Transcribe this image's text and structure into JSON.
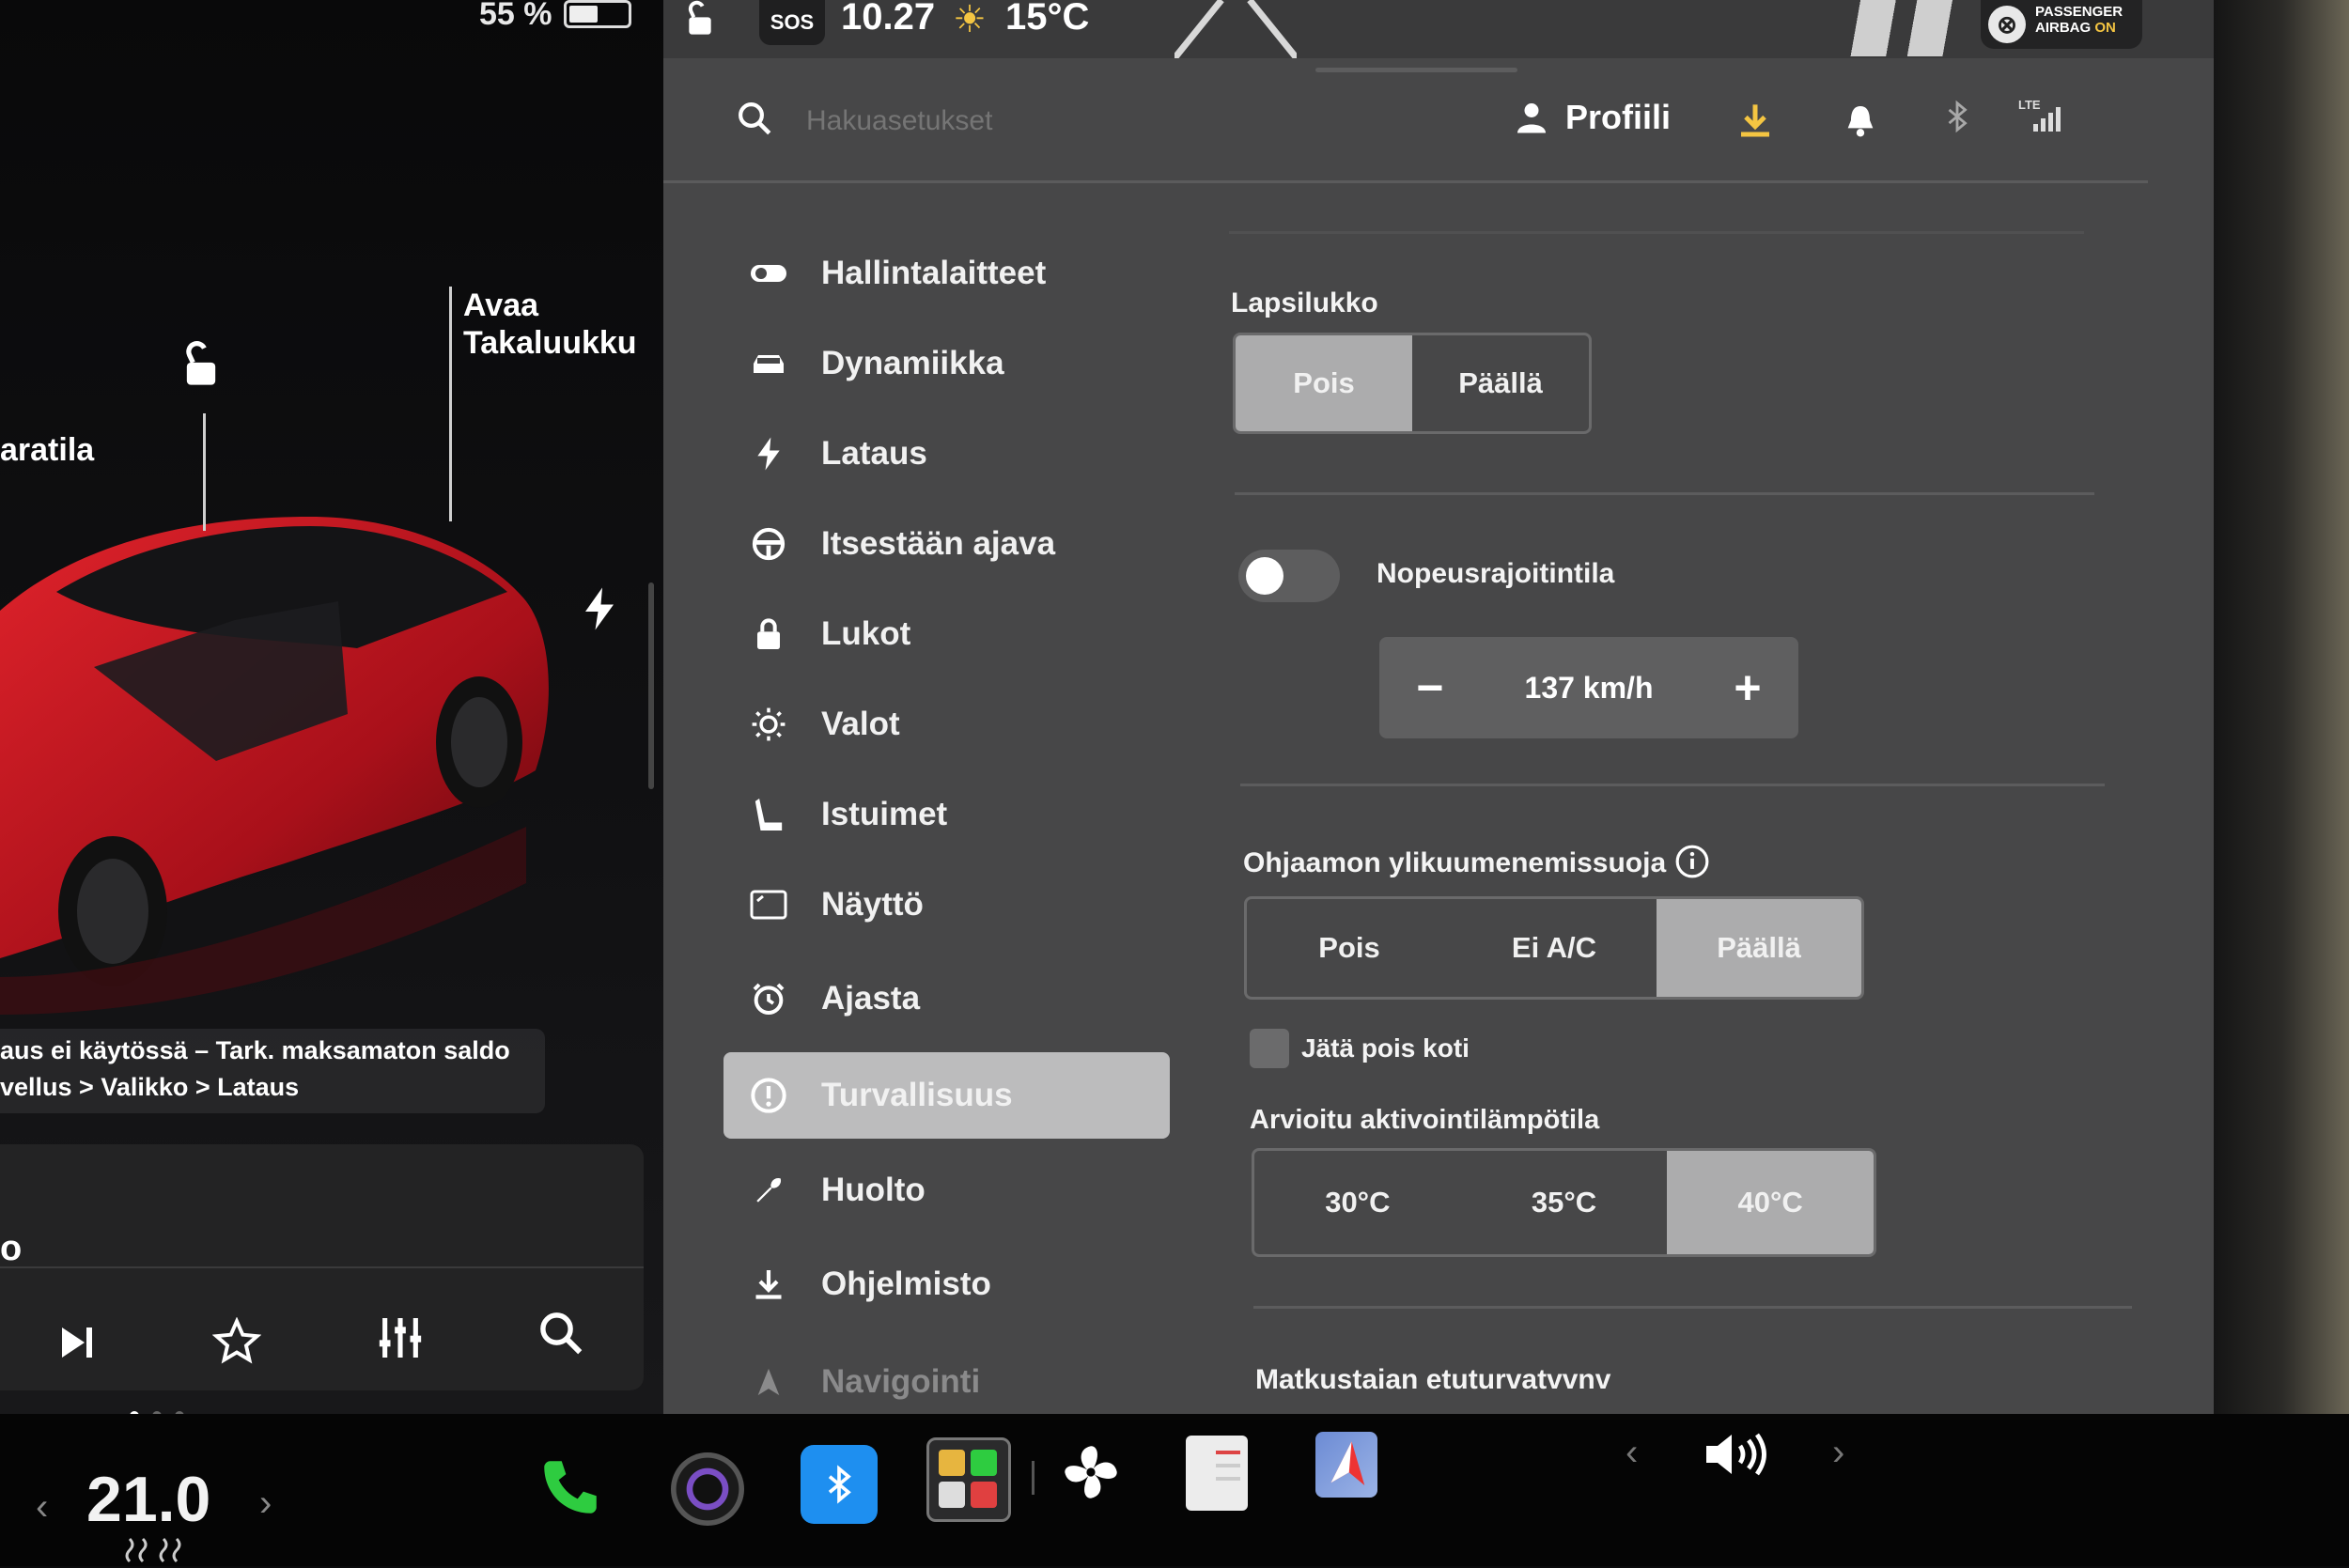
{
  "status": {
    "battery_pct": "55 %",
    "sos": "SOS",
    "time": "10.27",
    "temperature": "15°C",
    "airbag_line1": "PASSENGER",
    "airbag_line2": "AIRBAG",
    "airbag_state": "ON"
  },
  "header": {
    "search_placeholder": "Hakuasetukset",
    "profile_label": "Profiili",
    "lte_label": "LTE"
  },
  "car_panel": {
    "partial_mode": "aratila",
    "open_trunk_line1": "Avaa",
    "open_trunk_line2": "Takaluukku",
    "notice_line1": "aus ei käytössä – Tark. maksamaton saldo",
    "notice_line2": "vellus > Valikko > Lataus",
    "media_partial": "o"
  },
  "menu": [
    {
      "label": "Hallintalaitteet",
      "icon": "toggle-icon"
    },
    {
      "label": "Dynamiikka",
      "icon": "car-icon"
    },
    {
      "label": "Lataus",
      "icon": "bolt-icon"
    },
    {
      "label": "Itsestään ajava",
      "icon": "steering-wheel-icon"
    },
    {
      "label": "Lukot",
      "icon": "lock-icon"
    },
    {
      "label": "Valot",
      "icon": "sun-icon"
    },
    {
      "label": "Istuimet",
      "icon": "seat-icon"
    },
    {
      "label": "Näyttö",
      "icon": "display-icon"
    },
    {
      "label": "Ajasta",
      "icon": "alarm-icon"
    },
    {
      "label": "Turvallisuus",
      "icon": "alert-circle-icon",
      "active": true
    },
    {
      "label": "Huolto",
      "icon": "wrench-icon"
    },
    {
      "label": "Ohjelmisto",
      "icon": "download-icon"
    },
    {
      "label": "Navigointi",
      "icon": "navigation-icon"
    }
  ],
  "settings": {
    "child_lock": {
      "title": "Lapsilukko",
      "options": [
        "Pois",
        "Päällä"
      ],
      "selected": "Pois"
    },
    "speed_limit": {
      "title": "Nopeusrajoitintila",
      "enabled": false,
      "value": "137 km/h"
    },
    "cabin_overheat": {
      "title": "Ohjaamon ylikuumenemissuoja",
      "options": [
        "Pois",
        "Ei A/C",
        "Päällä"
      ],
      "selected": "Päällä",
      "exclude_home_label": "Jätä pois koti",
      "exclude_home_checked": false,
      "activation_title": "Arvioitu aktivointilämpötila",
      "activation_options": [
        "30°C",
        "35°C",
        "40°C"
      ],
      "activation_selected": "40°C"
    },
    "next_section_title": "Matkustaian etuturvatvvnv"
  },
  "dock": {
    "cabin_temp": "21.0"
  },
  "colors": {
    "accent_yellow": "#f4c542",
    "car_red": "#b3121c",
    "panel_gray": "#474748",
    "selected_gray": "#acacad"
  }
}
